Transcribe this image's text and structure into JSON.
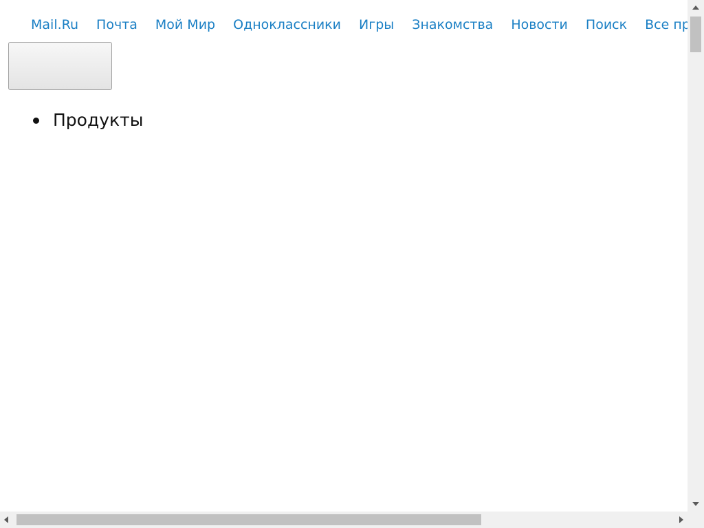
{
  "nav": {
    "links": [
      {
        "label": "Mail.Ru"
      },
      {
        "label": "Почта"
      },
      {
        "label": "Мой Мир"
      },
      {
        "label": "Одноклассники"
      },
      {
        "label": "Игры"
      },
      {
        "label": "Знакомства"
      },
      {
        "label": "Новости"
      },
      {
        "label": "Поиск"
      },
      {
        "label": "Все проекты"
      }
    ],
    "link_color": "#1a7fc4"
  },
  "blank_button": {
    "label": ""
  },
  "list": {
    "items": [
      {
        "label": "Продукты"
      }
    ]
  },
  "scrollbars": {
    "vertical": {
      "position": 0.0
    },
    "horizontal": {
      "position": 0.0
    }
  }
}
